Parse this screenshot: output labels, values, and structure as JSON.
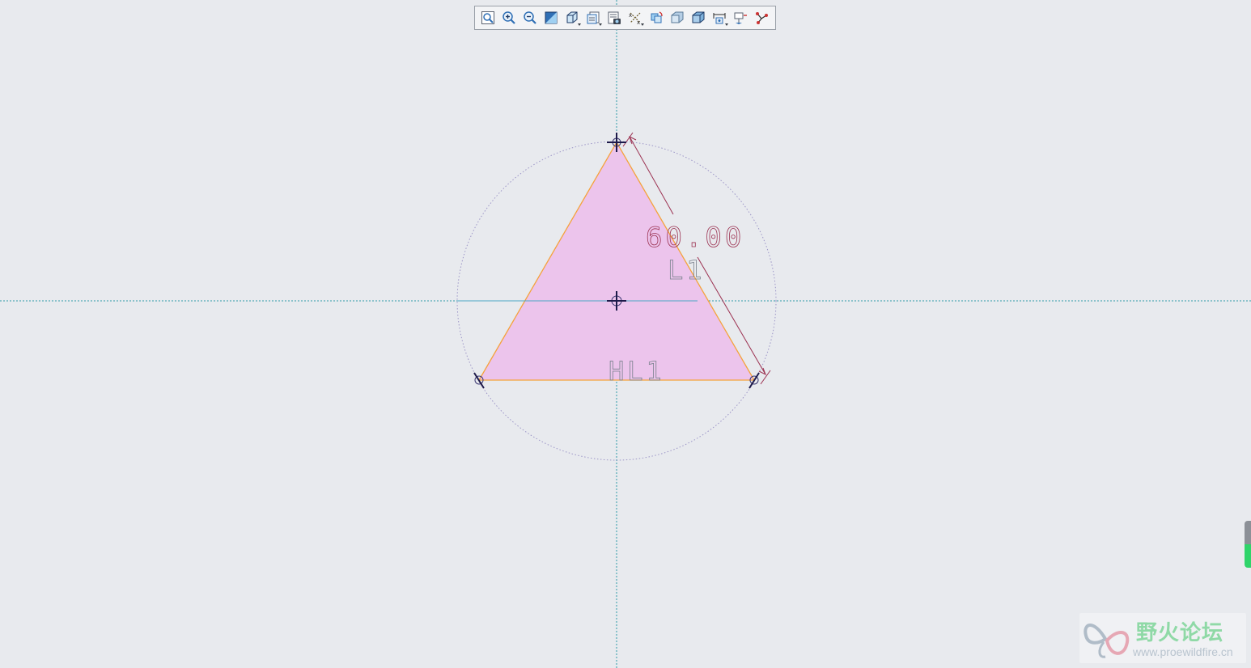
{
  "toolbar": {
    "buttons": [
      {
        "name": "refit-icon"
      },
      {
        "name": "zoom-in-icon"
      },
      {
        "name": "zoom-out-icon"
      },
      {
        "name": "repaint-icon"
      },
      {
        "name": "display-style-icon"
      },
      {
        "name": "saved-views-icon"
      },
      {
        "name": "view-manager-icon"
      },
      {
        "name": "datum-display-icon"
      },
      {
        "name": "rotate-center-icon"
      },
      {
        "name": "shading-icon"
      },
      {
        "name": "shading-edges-icon"
      },
      {
        "name": "display-dimensions-icon"
      },
      {
        "name": "sketch-orientation-icon"
      },
      {
        "name": "constraint-display-icon"
      }
    ]
  },
  "sketch": {
    "dimension_value": "60.00",
    "constraint_side": "L1",
    "constraint_base": "HL1"
  },
  "colors": {
    "background": "#e8eaee",
    "fill": "#ecc4ec",
    "edge": "#f5a23b",
    "dimension": "#9b3050",
    "centerline": "#2e9aa8",
    "construction_circle": "#9c95c7"
  },
  "watermark": {
    "title": "野火论坛",
    "url": "www.proewildfire.cn"
  }
}
